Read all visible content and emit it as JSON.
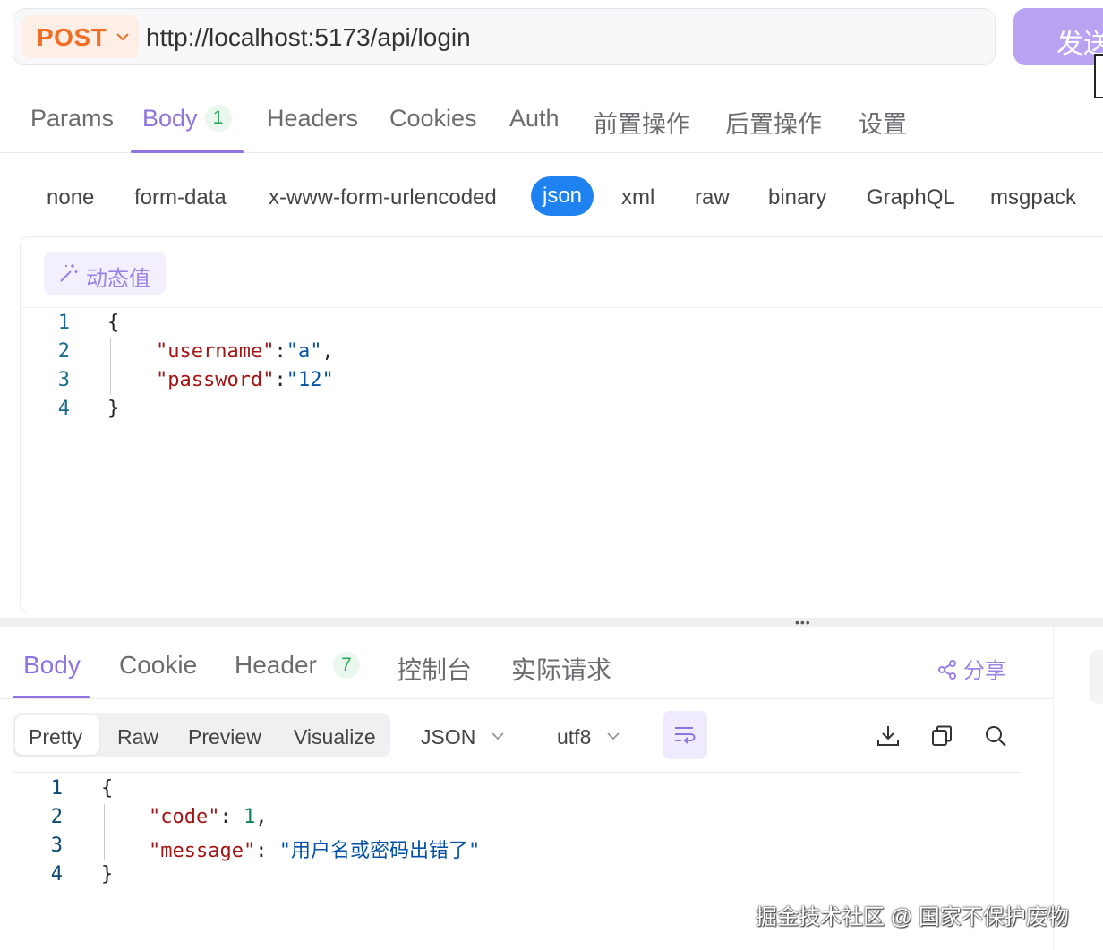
{
  "request": {
    "method": "POST",
    "url": "http://localhost:5173/api/login",
    "send_label": "发送"
  },
  "request_tabs": [
    {
      "label": "Params"
    },
    {
      "label": "Body",
      "badge": "1"
    },
    {
      "label": "Headers"
    },
    {
      "label": "Cookies"
    },
    {
      "label": "Auth"
    },
    {
      "label": "前置操作"
    },
    {
      "label": "后置操作"
    },
    {
      "label": "设置"
    }
  ],
  "body_types": [
    "none",
    "form-data",
    "x-www-form-urlencoded",
    "json",
    "xml",
    "raw",
    "binary",
    "GraphQL",
    "msgpack"
  ],
  "dynamic_value_label": "动态值",
  "request_body": {
    "line_numbers": [
      "1",
      "2",
      "3",
      "4"
    ],
    "open_brace": "{",
    "close_brace": "}",
    "key1": "\"username\"",
    "val1": "\"a\"",
    "key2": "\"password\"",
    "val2": "\"12\"",
    "colon": ":",
    "comma": ","
  },
  "response_tabs": [
    {
      "label": "Body"
    },
    {
      "label": "Cookie"
    },
    {
      "label": "Header",
      "badge": "7"
    },
    {
      "label": "控制台"
    },
    {
      "label": "实际请求"
    }
  ],
  "share_label": "分享",
  "view_modes": [
    "Pretty",
    "Raw",
    "Preview",
    "Visualize"
  ],
  "format_select": "JSON",
  "encoding_select": "utf8",
  "response_body": {
    "line_numbers": [
      "1",
      "2",
      "3",
      "4"
    ],
    "open_brace": "{",
    "close_brace": "}",
    "key1": "\"code\"",
    "val1": "1",
    "key2": "\"message\"",
    "val2": "\"用户名或密码出错了\"",
    "colon": ": ",
    "comma": ","
  },
  "watermark": "掘金技术社区 @ 国家不保护废物",
  "colors": {
    "accent": "#8f74e0",
    "method": "#f06e26",
    "send_button": "#b9a2f2",
    "json_chip": "#1e82f0",
    "badge_green": "#2aa855"
  }
}
